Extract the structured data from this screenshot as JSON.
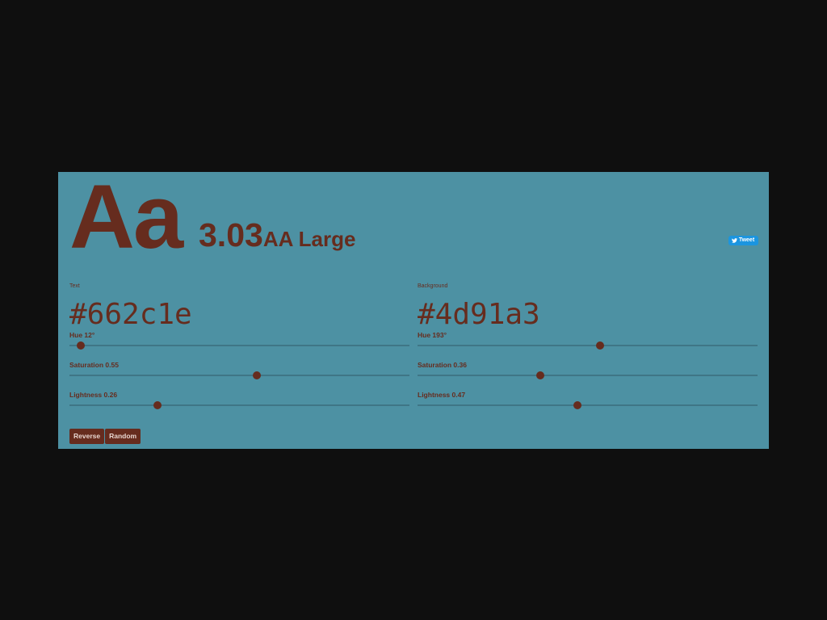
{
  "sample": "Aa",
  "contrast": {
    "ratio": "3.03",
    "rating": "AA Large"
  },
  "tweet_label": "Tweet",
  "colors": {
    "text": "#662c1e",
    "background": "#4d91a3"
  },
  "text_color": {
    "label": "Text",
    "hex": "#662c1e",
    "hue": {
      "label": "Hue 12°",
      "value": 12,
      "max": 360
    },
    "saturation": {
      "label": "Saturation 0.55",
      "value": 0.55,
      "max": 1
    },
    "lightness": {
      "label": "Lightness 0.26",
      "value": 0.26,
      "max": 1
    }
  },
  "background_color": {
    "label": "Background",
    "hex": "#4d91a3",
    "hue": {
      "label": "Hue 193°",
      "value": 193,
      "max": 360
    },
    "saturation": {
      "label": "Saturation 0.36",
      "value": 0.36,
      "max": 1
    },
    "lightness": {
      "label": "Lightness 0.47",
      "value": 0.47,
      "max": 1
    }
  },
  "buttons": {
    "reverse": "Reverse",
    "random": "Random"
  }
}
